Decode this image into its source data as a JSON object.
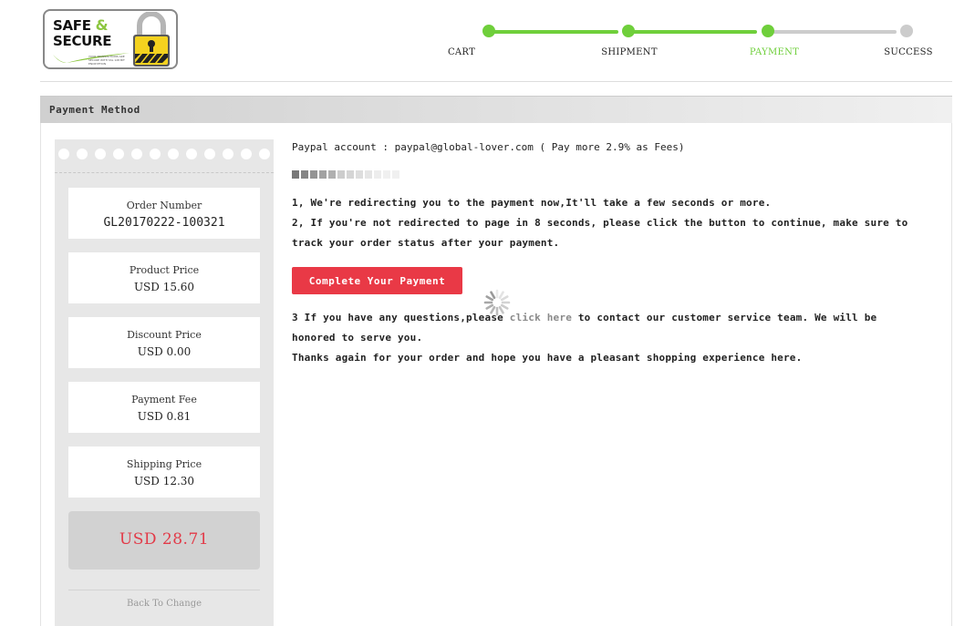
{
  "logo": {
    "line1": "SAFE",
    "amp": "&",
    "line2": "SECURE",
    "tagline": "YOUR TRANSACTIONS ARE SECURE WITH SSL 128 BIT ENCRYPTION"
  },
  "steps": [
    {
      "label": "CART",
      "state": "done"
    },
    {
      "label": "SHIPMENT",
      "state": "done"
    },
    {
      "label": "PAYMENT",
      "state": "current"
    },
    {
      "label": "SUCCESS",
      "state": "todo"
    }
  ],
  "colors": {
    "accent_green": "#6fcf3b",
    "inactive_gray": "#cccccc",
    "current_label": "#6fcf3b",
    "pay_button": "#e93946",
    "total_red": "#e23a48"
  },
  "section": {
    "title": "Payment Method"
  },
  "receipt": {
    "order_number_label": "Order Number",
    "order_number": "GL20170222-100321",
    "product_price_label": "Product Price",
    "product_price": "USD 15.60",
    "discount_price_label": "Discount Price",
    "discount_price": "USD 0.00",
    "payment_fee_label": "Payment Fee",
    "payment_fee": "USD 0.81",
    "shipping_price_label": "Shipping Price",
    "shipping_price": "USD 12.30",
    "total": "USD 28.71",
    "back_link": "Back To Change"
  },
  "main": {
    "account_line": "Paypal account : paypal@global-lover.com ( Pay more 2.9% as Fees)",
    "redirect_progress": 0.45,
    "line1": "1, We're redirecting you to the payment now,It'll take a few seconds or more.",
    "line2a": "2, If you're not redirected to page in 8 seconds, please click the button to continue, make sure to",
    "line2b": "track your order status after your payment.",
    "pay_button": "Complete Your Payment",
    "line3_prefix": "3 If you have any questions,please ",
    "line3_link": "click here",
    "line3_suffix": " to contact our customer service team. We will be",
    "line3b": "honored to serve you.",
    "line4": "Thanks again for your order and hope you have a pleasant shopping experience here."
  }
}
